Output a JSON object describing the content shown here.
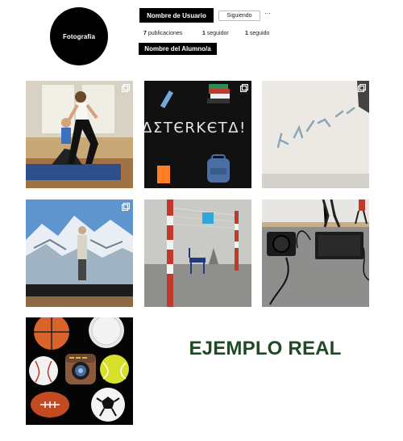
{
  "profile": {
    "avatar_label": "Fotografía",
    "username": "Nombre de Usuario",
    "follow_button": "Siguiendo",
    "more_options": "···",
    "stats": {
      "posts_count": "7",
      "posts_label": "publicaciones",
      "followers_count": "1",
      "followers_label": "seguidor",
      "following_count": "1",
      "following_label": "seguido"
    },
    "full_name": "Nombre del Alumno/a"
  },
  "posts": [
    {
      "subject": "yoga-stretch-photo",
      "multiple": true
    },
    {
      "subject": "chalkboard-doodle-photo",
      "multiple": true,
      "chalk_text": "ΔƩТЄRKЄТΔ!"
    },
    {
      "subject": "whiteboard-writing-photo",
      "multiple": true
    },
    {
      "subject": "snowy-mountain-projection-photo",
      "multiple": true
    },
    {
      "subject": "gym-net-posts-photo",
      "multiple": false
    },
    {
      "subject": "gym-floor-equipment-photo",
      "multiple": false
    },
    {
      "subject": "sports-balls-logo-collage",
      "multiple": false
    }
  ],
  "caption": "EJEMPLO REAL",
  "colors": {
    "caption": "#1f4a25",
    "black": "#000000"
  }
}
